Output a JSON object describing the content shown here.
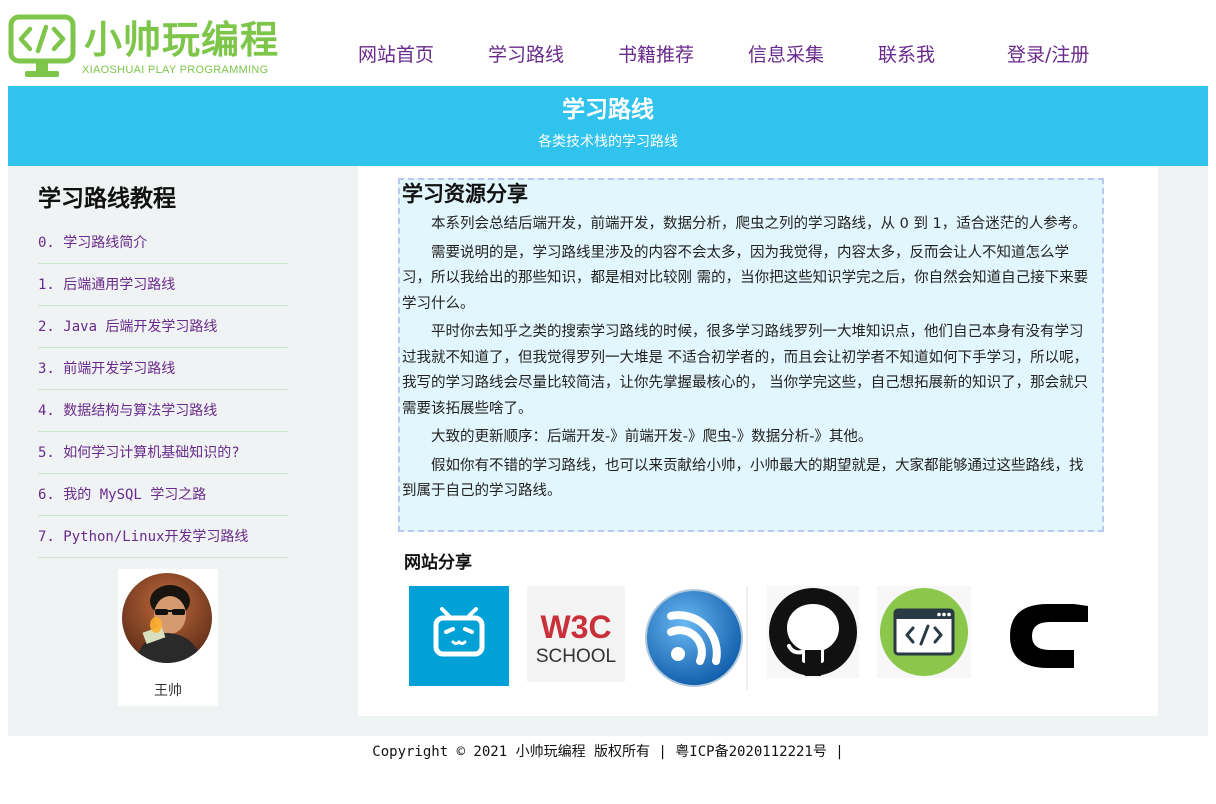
{
  "header": {
    "logo_title": "小帅玩编程",
    "logo_subtitle": "XIAOSHUAI PLAY PROGRAMMING",
    "brand_color": "#7dc64a",
    "nav": [
      {
        "label": "网站首页"
      },
      {
        "label": "学习路线"
      },
      {
        "label": "书籍推荐"
      },
      {
        "label": "信息采集"
      },
      {
        "label": "联系我"
      },
      {
        "label": "登录/注册"
      }
    ]
  },
  "banner": {
    "title": "学习路线",
    "subtitle": "各类技术栈的学习路线",
    "bg_color": "#2fc3ed"
  },
  "sidebar": {
    "title": "学习路线教程",
    "items": [
      {
        "label": "0. 学习路线简介"
      },
      {
        "label": "1. 后端通用学习路线"
      },
      {
        "label": "2. Java 后端开发学习路线"
      },
      {
        "label": "3. 前端开发学习路线"
      },
      {
        "label": "4. 数据结构与算法学习路线"
      },
      {
        "label": "5. 如何学习计算机基础知识的?"
      },
      {
        "label": "6. 我的 MySQL 学习之路"
      },
      {
        "label": "7. Python/Linux开发学习路线"
      }
    ],
    "avatar_name": "王帅"
  },
  "main": {
    "share_title": "学习资源分享",
    "paragraphs": [
      "本系列会总结后端开发，前端开发，数据分析，爬虫之列的学习路线，从 0 到 1，适合迷茫的人参考。",
      "需要说明的是，学习路线里涉及的内容不会太多，因为我觉得，内容太多，反而会让人不知道怎么学习，所以我给出的那些知识，都是相对比较刚 需的，当你把这些知识学完之后，你自然会知道自己接下来要学习什么。",
      "平时你去知乎之类的搜索学习路线的时候，很多学习路线罗列一大堆知识点，他们自己本身有没有学习过我就不知道了，但我觉得罗列一大堆是 不适合初学者的，而且会让初学者不知道如何下手学习，所以呢，我写的学习路线会尽量比较简洁，让你先掌握最核心的， 当你学完这些，自己想拓展新的知识了，那会就只需要该拓展些啥了。",
      "大致的更新顺序：后端开发-》前端开发-》爬虫-》数据分析-》其他。",
      "假如你有不错的学习路线，也可以来贡献给小帅，小帅最大的期望就是，大家都能够通过这些路线，找到属于自己的学习路线。"
    ],
    "sites_title": "网站分享",
    "sites": [
      {
        "icon": "bilibili-icon",
        "color": "#00a1d6"
      },
      {
        "icon": "w3cschool-icon",
        "line1": "W3C",
        "line2": "SCHOOL"
      },
      {
        "icon": "rss-icon",
        "color": "#1b74c9"
      },
      {
        "icon": "github-icon",
        "color": "#111111"
      },
      {
        "icon": "code-icon",
        "color": "#8bc74a"
      },
      {
        "icon": "c-language-icon",
        "color": "#000000"
      }
    ]
  },
  "footer": {
    "copyright": "Copyright © 2021 小帅玩编程 版权所有 | 粤ICP备2020112221号 |"
  }
}
